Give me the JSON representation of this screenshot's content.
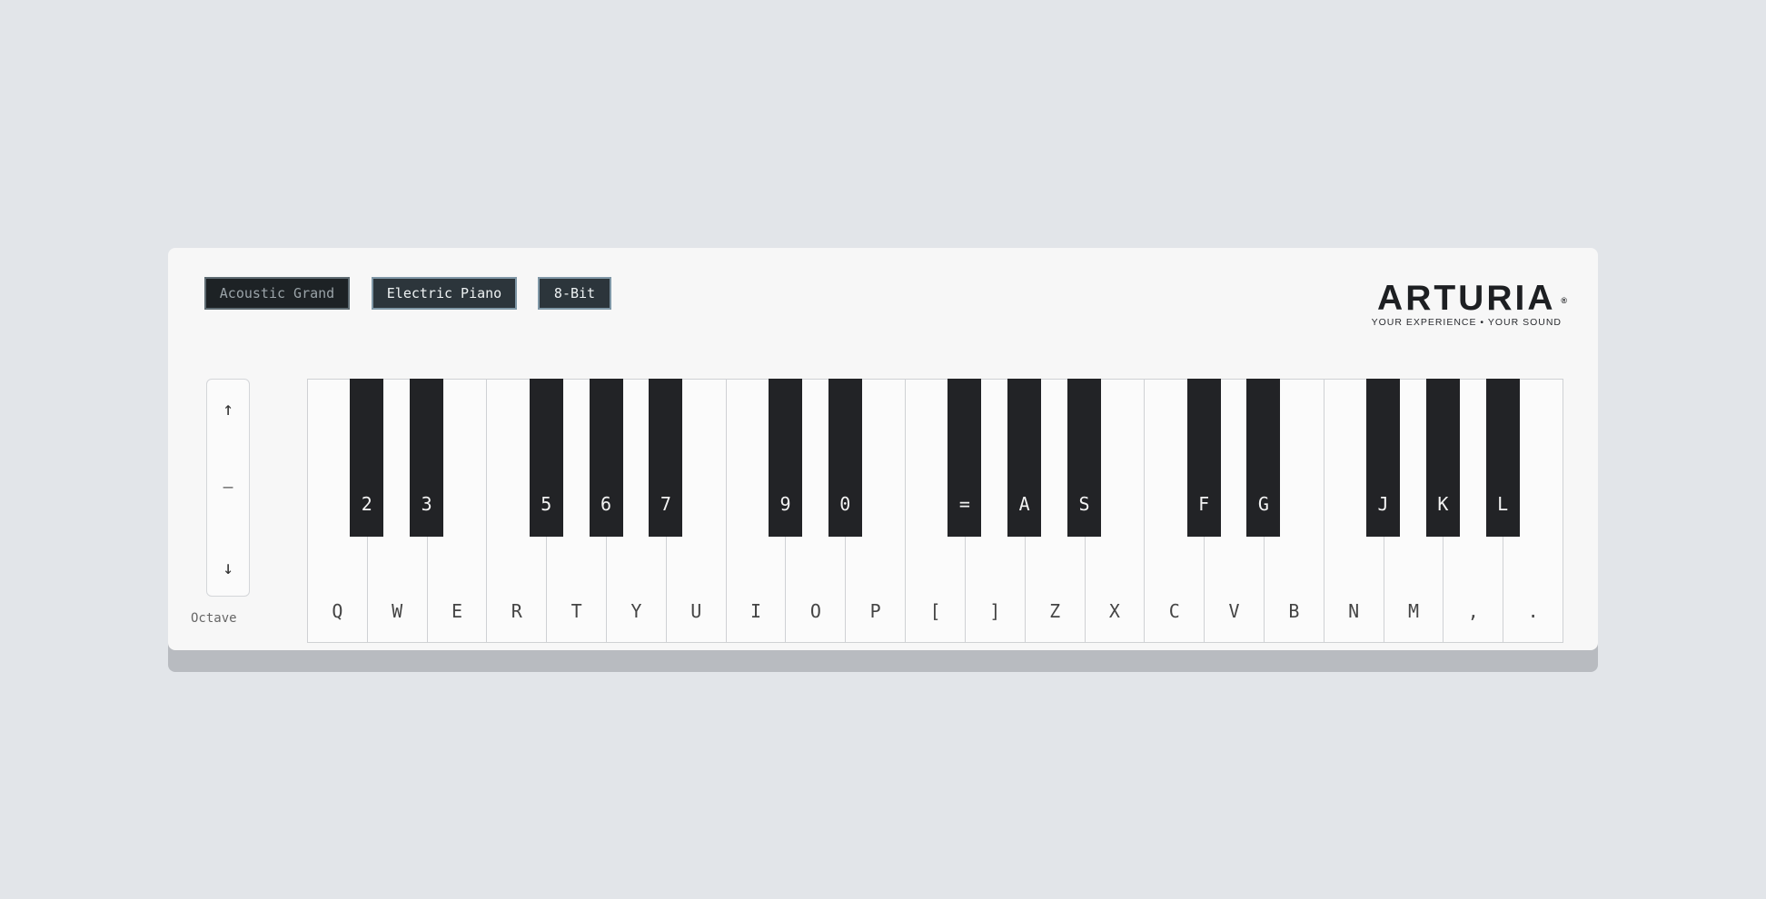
{
  "presets": [
    {
      "label": "Acoustic Grand",
      "active": true
    },
    {
      "label": "Electric Piano",
      "active": false
    },
    {
      "label": "8-Bit",
      "active": false
    }
  ],
  "logo": {
    "wordmark": "ARTURIA",
    "registered": "®",
    "tagline": "YOUR EXPERIENCE • YOUR SOUND"
  },
  "octave": {
    "up": "↑",
    "reset": "—",
    "down": "↓",
    "label": "Octave"
  },
  "white_keys": [
    "Q",
    "W",
    "E",
    "R",
    "T",
    "Y",
    "U",
    "I",
    "O",
    "P",
    "[",
    "]",
    "Z",
    "X",
    "C",
    "V",
    "B",
    "N",
    "M",
    ",",
    "."
  ],
  "black_keys": [
    "2",
    "3",
    "5",
    "6",
    "7",
    "9",
    "0",
    "=",
    "A",
    "S",
    "F",
    "G",
    "J",
    "K",
    "L"
  ],
  "colors": {
    "background": "#e2e5e9",
    "panel": "#f7f7f7",
    "black_key": "#222326",
    "preset_bg": "#2c353b",
    "preset_border": "#7f97a6"
  }
}
